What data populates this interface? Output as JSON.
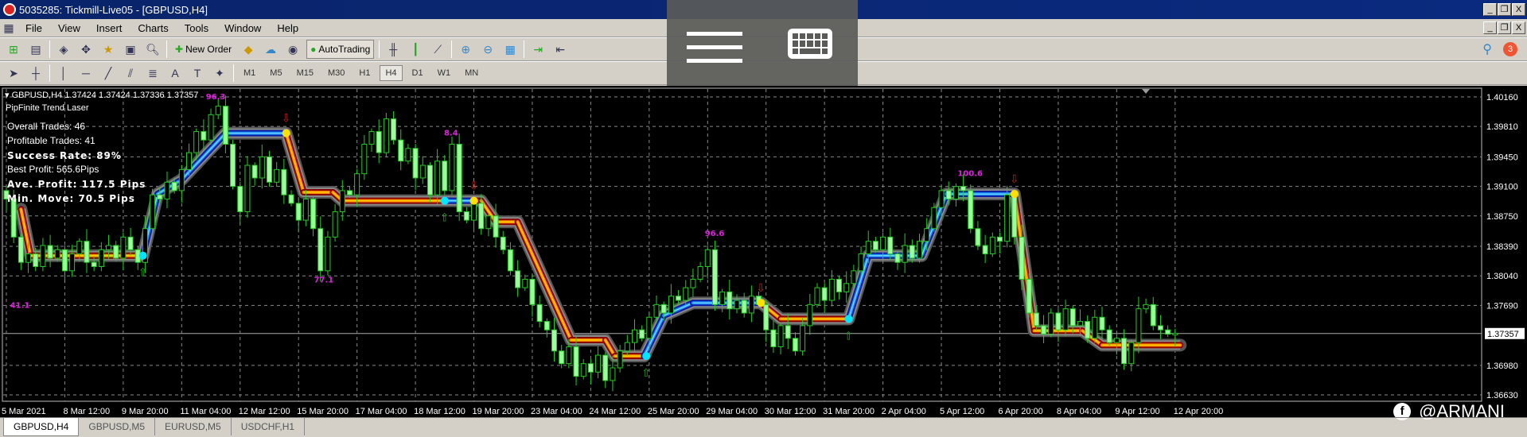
{
  "window": {
    "title": "5035285: Tickmill-Live05 - [GBPUSD,H4]"
  },
  "menu": [
    "File",
    "View",
    "Insert",
    "Charts",
    "Tools",
    "Window",
    "Help"
  ],
  "toolbar": {
    "new_order": "New Order",
    "autotrading": "AutoTrading",
    "notification_count": "3"
  },
  "timeframes": [
    "M1",
    "M5",
    "M15",
    "M30",
    "H1",
    "H4",
    "D1",
    "W1",
    "MN"
  ],
  "active_timeframe": "H4",
  "chart": {
    "header": "GBPUSD,H4  1.37424 1.37424 1.37336 1.37357",
    "indicator": "PipFinite Trend Laser",
    "stats": {
      "overall": "Overall Trades: 46",
      "profitable": "Profitable Trades: 41",
      "success": "Success Rate: 89%",
      "best": "Best Profit: 565.6Pips",
      "avg": "Ave. Profit: 117.5 Pips",
      "min": "Min. Move: 70.5 Pips"
    },
    "current_price": "1.37357",
    "watermark": "@ARMANI"
  },
  "tabs": [
    "GBPUSD,H4",
    "GBPUSD,M5",
    "EURUSD,M5",
    "USDCHF,H1"
  ],
  "chart_data": {
    "type": "candlestick",
    "symbol": "GBPUSD",
    "timeframe": "H4",
    "ylim": [
      1.3663,
      1.4016
    ],
    "y_ticks": [
      "1.40160",
      "1.39810",
      "1.39450",
      "1.39100",
      "1.38750",
      "1.38390",
      "1.38040",
      "1.37690",
      "1.37357",
      "1.36980",
      "1.36630"
    ],
    "x_ticks": [
      "5 Mar 2021",
      "8 Mar 12:00",
      "9 Mar 20:00",
      "11 Mar 04:00",
      "12 Mar 12:00",
      "15 Mar 20:00",
      "17 Mar 04:00",
      "18 Mar 12:00",
      "19 Mar 20:00",
      "23 Mar 04:00",
      "24 Mar 12:00",
      "25 Mar 20:00",
      "29 Mar 04:00",
      "30 Mar 12:00",
      "31 Mar 20:00",
      "2 Apr 04:00",
      "5 Apr 12:00",
      "6 Apr 20:00",
      "8 Apr 04:00",
      "9 Apr 12:00",
      "12 Apr 20:00"
    ],
    "bars_per_tick": 8,
    "closes": [
      1.3895,
      1.385,
      1.382,
      1.383,
      1.3815,
      1.384,
      1.3825,
      1.3835,
      1.381,
      1.383,
      1.3845,
      1.382,
      1.3815,
      1.3835,
      1.384,
      1.3825,
      1.385,
      1.3835,
      1.382,
      1.386,
      1.39,
      1.3895,
      1.3915,
      1.3905,
      1.393,
      1.395,
      1.3975,
      1.3965,
      1.3995,
      1.4005,
      1.396,
      1.391,
      1.388,
      1.3935,
      1.392,
      1.3945,
      1.3915,
      1.393,
      1.39,
      1.389,
      1.387,
      1.3895,
      1.386,
      1.381,
      1.385,
      1.388,
      1.3905,
      1.39,
      1.3925,
      1.396,
      1.3975,
      1.395,
      1.399,
      1.3965,
      1.394,
      1.3955,
      1.392,
      1.3935,
      1.39,
      1.394,
      1.3905,
      1.396,
      1.388,
      1.387,
      1.389,
      1.386,
      1.3875,
      1.385,
      1.3835,
      1.381,
      1.379,
      1.38,
      1.377,
      1.375,
      1.374,
      1.3715,
      1.37,
      1.372,
      1.3685,
      1.37,
      1.369,
      1.371,
      1.368,
      1.3695,
      1.3715,
      1.3725,
      1.374,
      1.373,
      1.3755,
      1.377,
      1.376,
      1.378,
      1.3775,
      1.379,
      1.38,
      1.3815,
      1.3835,
      1.377,
      1.3785,
      1.3765,
      1.3775,
      1.376,
      1.378,
      1.377,
      1.374,
      1.372,
      1.3745,
      1.373,
      1.3715,
      1.3745,
      1.377,
      1.379,
      1.3775,
      1.38,
      1.3785,
      1.3795,
      1.381,
      1.383,
      1.3845,
      1.3835,
      1.385,
      1.383,
      1.382,
      1.384,
      1.3825,
      1.3845,
      1.386,
      1.3885,
      1.3905,
      1.3895,
      1.391,
      1.3905,
      1.386,
      1.384,
      1.383,
      1.385,
      1.3845,
      1.39,
      1.385,
      1.38,
      1.376,
      1.3745,
      1.3735,
      1.376,
      1.374,
      1.3765,
      1.3745,
      1.375,
      1.373,
      1.3755,
      1.374,
      1.3725,
      1.373,
      1.37,
      1.3725,
      1.3765,
      1.377,
      1.3745,
      1.374,
      1.3735,
      1.3736
    ],
    "laser": [
      [
        2,
        1.3883,
        "down"
      ],
      [
        3.3,
        1.3828,
        "down"
      ],
      [
        18.7,
        1.3828,
        "up"
      ],
      [
        20.7,
        1.3901,
        "up"
      ],
      [
        24,
        1.3918,
        "up"
      ],
      [
        30,
        1.3973,
        "up"
      ],
      [
        38.3,
        1.3973,
        "down"
      ],
      [
        40.7,
        1.3903,
        "down"
      ],
      [
        44.7,
        1.3903,
        "down"
      ],
      [
        46,
        1.3893,
        "down"
      ],
      [
        60,
        1.3893,
        "up"
      ],
      [
        64,
        1.3893,
        "down"
      ],
      [
        65,
        1.3893,
        "down"
      ],
      [
        67,
        1.3868,
        "down"
      ],
      [
        70,
        1.3868,
        "down"
      ],
      [
        77.3,
        1.3728,
        "down"
      ],
      [
        82,
        1.3728,
        "down"
      ],
      [
        83.3,
        1.3709,
        "down"
      ],
      [
        87.3,
        1.3709,
        "up"
      ],
      [
        90,
        1.3757,
        "up"
      ],
      [
        94,
        1.3772,
        "up"
      ],
      [
        103.3,
        1.3772,
        "down"
      ],
      [
        106,
        1.3753,
        "down"
      ],
      [
        115.3,
        1.3753,
        "up"
      ],
      [
        118,
        1.3828,
        "up"
      ],
      [
        125.3,
        1.3828,
        "up"
      ],
      [
        128.7,
        1.3901,
        "up"
      ],
      [
        138,
        1.3901,
        "down"
      ],
      [
        140.7,
        1.3739,
        "down"
      ],
      [
        147.3,
        1.3739,
        "down"
      ],
      [
        150,
        1.3722,
        "down"
      ],
      [
        160.7,
        1.3722,
        "down"
      ]
    ],
    "signals": [
      {
        "bar": 18.7,
        "price": 1.3828,
        "type": "buy"
      },
      {
        "bar": 38.3,
        "price": 1.3973,
        "type": "sell"
      },
      {
        "bar": 60,
        "price": 1.3893,
        "type": "buy"
      },
      {
        "bar": 64,
        "price": 1.3893,
        "type": "sell"
      },
      {
        "bar": 87.6,
        "price": 1.3709,
        "type": "buy"
      },
      {
        "bar": 103.3,
        "price": 1.3772,
        "type": "sell"
      },
      {
        "bar": 115.3,
        "price": 1.3753,
        "type": "buy"
      },
      {
        "bar": 138,
        "price": 1.3901,
        "type": "sell"
      }
    ],
    "profit_labels": [
      {
        "bar": 28.4,
        "price": 1.4017,
        "text": "96.3"
      },
      {
        "bar": 1.6,
        "price": 1.377,
        "text": "41.1"
      },
      {
        "bar": 43.2,
        "price": 1.38,
        "text": "77.1"
      },
      {
        "bar": 61,
        "price": 1.3974,
        "text": "8.4"
      },
      {
        "bar": 96.7,
        "price": 1.3855,
        "text": "96.6"
      },
      {
        "bar": 131.3,
        "price": 1.3926,
        "text": "100.6"
      }
    ],
    "colors": {
      "bull": "#9aff9a",
      "wick": "#22cc22",
      "up_laser": "#1e90ff",
      "down_laser": "#ff8c00",
      "label": "#e020e0"
    }
  }
}
